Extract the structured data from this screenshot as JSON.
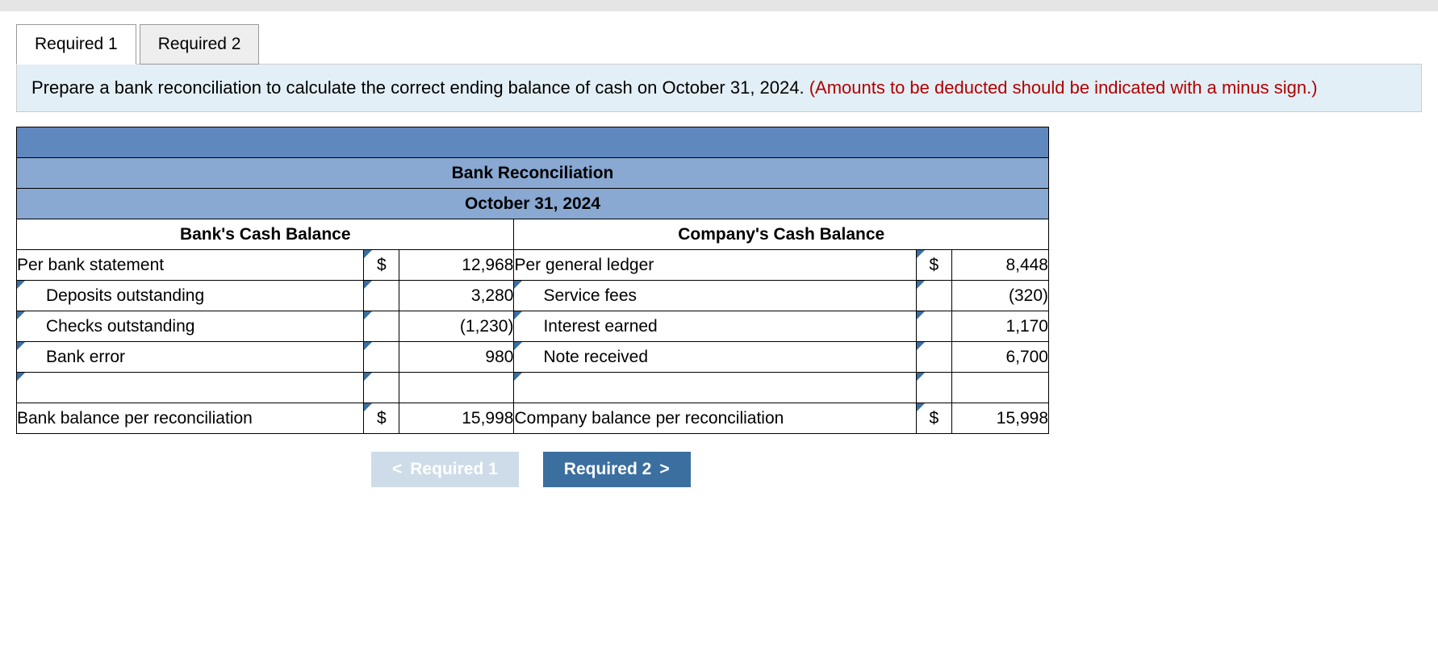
{
  "tabs": {
    "tab1": "Required 1",
    "tab2": "Required 2"
  },
  "instructions": {
    "main": "Prepare a bank reconciliation to calculate the correct ending balance of cash on October 31, 2024. ",
    "red": "(Amounts to be deducted should be indicated with a minus sign.)"
  },
  "table": {
    "title": "Bank Reconciliation",
    "date": "October 31, 2024",
    "bank_header": "Bank's Cash Balance",
    "company_header": "Company's Cash Balance",
    "bank": {
      "per_statement_label": "Per bank statement",
      "per_statement_value": "12,968",
      "r1_label": "Deposits outstanding",
      "r1_value": "3,280",
      "r2_label": "Checks outstanding",
      "r2_value": "(1,230)",
      "r3_label": "Bank error",
      "r3_value": "980",
      "total_label": "Bank balance per reconciliation",
      "total_value": "15,998"
    },
    "company": {
      "per_ledger_label": "Per general ledger",
      "per_ledger_value": "8,448",
      "r1_label": "Service fees",
      "r1_value": "(320)",
      "r2_label": "Interest earned",
      "r2_value": "1,170",
      "r3_label": "Note received",
      "r3_value": "6,700",
      "total_label": "Company balance per reconciliation",
      "total_value": "15,998"
    },
    "dollar": "$"
  },
  "nav": {
    "prev": "Required 1",
    "next": "Required 2"
  }
}
